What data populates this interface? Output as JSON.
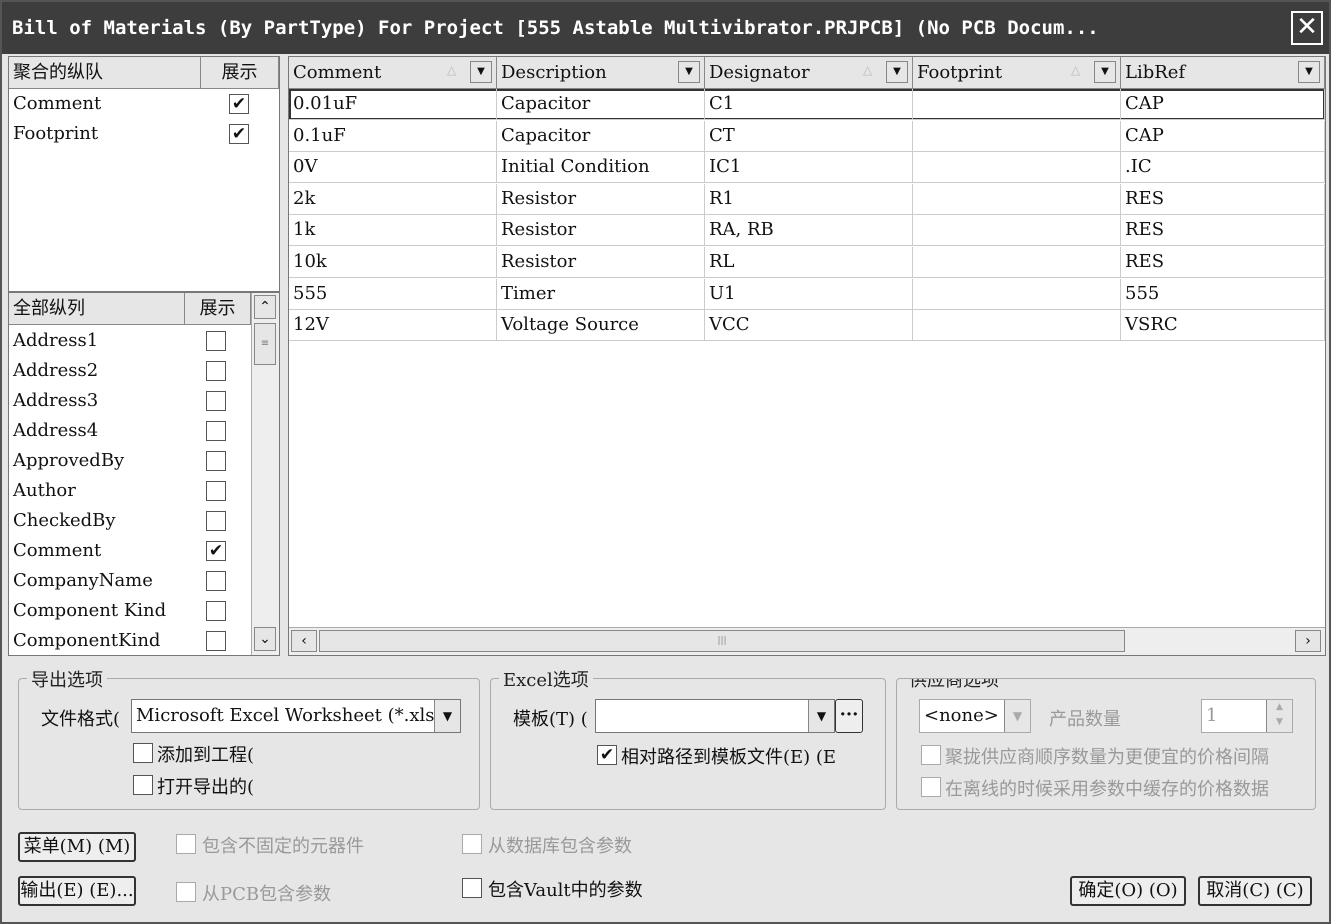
{
  "window": {
    "title": "Bill of Materials (By PartType) For Project [555 Astable Multivibrator.PRJPCB] (No PCB Docum...",
    "close": "✕"
  },
  "grouped": {
    "header_col": "聚合的纵队",
    "header_show": "展示",
    "items": [
      {
        "label": "Comment",
        "checked": "✔"
      },
      {
        "label": "Footprint",
        "checked": "✔"
      }
    ]
  },
  "all_columns": {
    "header_col": "全部纵列",
    "header_show": "展示",
    "items": [
      {
        "label": "Address1",
        "checked": ""
      },
      {
        "label": "Address2",
        "checked": ""
      },
      {
        "label": "Address3",
        "checked": ""
      },
      {
        "label": "Address4",
        "checked": ""
      },
      {
        "label": "ApprovedBy",
        "checked": ""
      },
      {
        "label": "Author",
        "checked": ""
      },
      {
        "label": "CheckedBy",
        "checked": ""
      },
      {
        "label": "Comment",
        "checked": "✔"
      },
      {
        "label": "CompanyName",
        "checked": ""
      },
      {
        "label": "Component Kind",
        "checked": ""
      },
      {
        "label": "ComponentKind",
        "checked": ""
      }
    ]
  },
  "grid": {
    "columns": [
      "Comment",
      "Description",
      "Designator",
      "Footprint",
      "LibRef"
    ],
    "rows": [
      [
        "0.01uF",
        "Capacitor",
        "C1",
        "",
        "CAP"
      ],
      [
        "0.1uF",
        "Capacitor",
        "CT",
        "",
        "CAP"
      ],
      [
        "0V",
        "Initial Condition",
        "IC1",
        "",
        ".IC"
      ],
      [
        "2k",
        "Resistor",
        "R1",
        "",
        "RES"
      ],
      [
        "1k",
        "Resistor",
        "RA, RB",
        "",
        "RES"
      ],
      [
        "10k",
        "Resistor",
        "RL",
        "",
        "RES"
      ],
      [
        "555",
        "Timer",
        "U1",
        "",
        "555"
      ],
      [
        "12V",
        "Voltage Source",
        "VCC",
        "",
        "VSRC"
      ]
    ]
  },
  "export": {
    "group_label": "导出选项",
    "file_format_label": "文件格式(",
    "file_format_value": "Microsoft Excel Worksheet (*.xls)",
    "add_to_project": "添加到工程(",
    "open_exported": "打开导出的("
  },
  "excel": {
    "group_label": "Excel选项",
    "template_label": "模板(T) (",
    "template_value": "",
    "browse": "···",
    "relative_path": "相对路径到模板文件(E) (E",
    "relative_checked": "✔"
  },
  "supplier": {
    "group_label": "供应商选项",
    "supplier_value": "<none>",
    "qty_label": "产品数量",
    "qty_value": "1",
    "option1": "聚拢供应商顺序数量为更便宜的价格间隔",
    "option2": "在离线的时候采用参数中缓存的价格数据"
  },
  "bottom": {
    "menu_btn": "菜单(M) (M)",
    "export_btn": "输出(E) (E)...",
    "include_unfixed": "包含不固定的元器件",
    "include_from_pcb": "从PCB包含参数",
    "include_from_db": "从数据库包含参数",
    "include_vault": "包含Vault中的参数",
    "ok_btn": "确定(O) (O)",
    "cancel_btn": "取消(C) (C)"
  }
}
